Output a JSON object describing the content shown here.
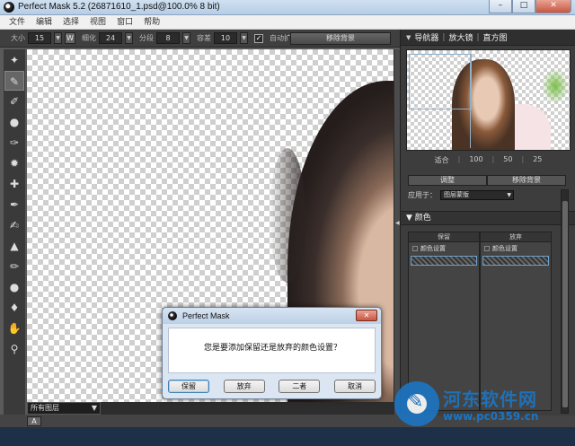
{
  "window": {
    "title": "Perfect Mask 5.2 (26871610_1.psd@100.0% 8 bit)",
    "buttons": [
      "–",
      "□",
      "✕"
    ]
  },
  "menu": [
    "文件",
    "编辑",
    "选择",
    "视图",
    "窗口",
    "帮助"
  ],
  "options": {
    "size_label": "大小",
    "size_value": "15",
    "w_label": "W",
    "detail_label": "细化",
    "detail_value": "24",
    "split_label": "分段",
    "split_value": "8",
    "tolerance_label": "容差",
    "tolerance_value": "10",
    "auto_expand_label": "自动扩展",
    "auto_expand_checked": "✓",
    "remove_bg_label": "移除背景"
  },
  "tools": [
    "✦",
    "✎",
    "✐",
    "●",
    "✑",
    "✹",
    "✚",
    "✒",
    "✍",
    "▲",
    "✏",
    "●",
    "♦",
    "✋",
    "⚲"
  ],
  "layer_select": {
    "value": "所有图层",
    "arrow": "▼"
  },
  "bottom_button": "A",
  "panel": {
    "tab_navigator": "导航器",
    "tab_magnifier": "放大镜",
    "tab_histogram": "直方图",
    "zoom": [
      "适合",
      "100",
      "50",
      "25"
    ],
    "adjust_label": "调整",
    "remove_bg_label": "移除背景",
    "apply_to_label": "应用于：",
    "apply_to_value": "图层蒙版",
    "color_section": "颜色",
    "keep_header": "保留",
    "drop_header": "放弃",
    "keep_item": "颜色设置",
    "drop_item": "颜色设置"
  },
  "dialog": {
    "title": "Perfect Mask",
    "message": "您是要添加保留还是放弃的颜色设置？",
    "buttons": [
      "保留",
      "放弃",
      "二者",
      "取消"
    ],
    "close": "✕"
  },
  "watermark": {
    "name": "河东软件网",
    "url": "www.pc0359.cn"
  }
}
